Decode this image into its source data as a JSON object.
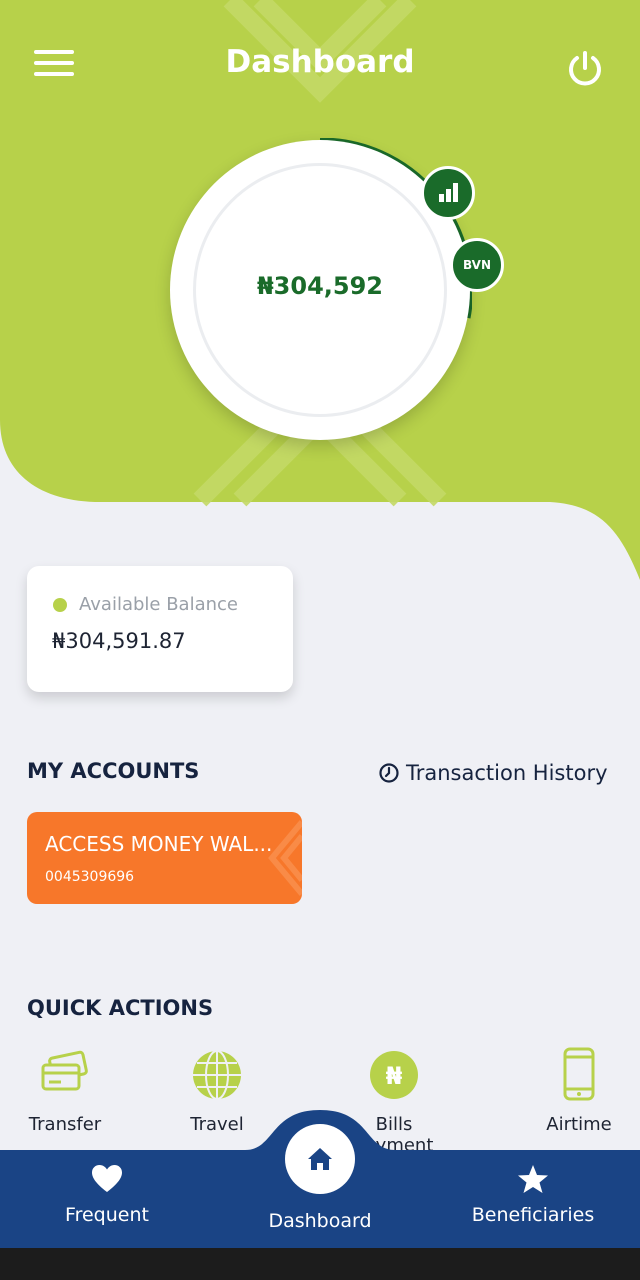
{
  "header": {
    "title": "Dashboard",
    "menu_icon": "hamburger-menu-icon",
    "power_icon": "power-icon"
  },
  "balance_circle": {
    "amount": "₦304,592",
    "stats_icon": "bar-chart-icon",
    "bvn_label": "BVN"
  },
  "available_balance": {
    "label": "Available Balance",
    "value": "₦304,591.87"
  },
  "accounts": {
    "title": "MY ACCOUNTS",
    "history_label": "Transaction History",
    "items": [
      {
        "name": "ACCESS MONEY WAL...",
        "number": "0045309696"
      }
    ]
  },
  "quick_actions": {
    "title": "QUICK ACTIONS",
    "items": [
      {
        "label": "Transfer",
        "icon": "cards-icon"
      },
      {
        "label": "Travel",
        "icon": "globe-icon"
      },
      {
        "label": "Bills Payment",
        "icon": "naira-icon"
      },
      {
        "label": "Airtime",
        "icon": "phone-icon"
      }
    ]
  },
  "bottom_nav": {
    "items": [
      {
        "label": "Frequent",
        "icon": "heart-icon"
      },
      {
        "label": "Dashboard",
        "icon": "home-icon"
      },
      {
        "label": "Beneficiaries",
        "icon": "star-icon"
      }
    ]
  },
  "colors": {
    "lime": "#b7d14a",
    "dark_green": "#1a6b2a",
    "orange": "#f7772a",
    "navy": "#1a4485",
    "background": "#eff0f5"
  }
}
